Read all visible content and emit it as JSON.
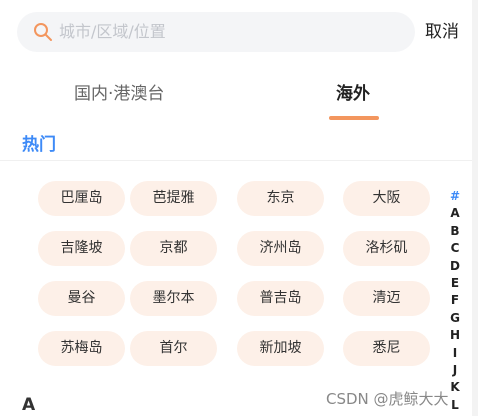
{
  "search": {
    "icon": "search-icon",
    "placeholder": "城市/区域/位置",
    "accent_color": "#f3965e"
  },
  "cancel_label": "取消",
  "tabs": [
    {
      "label": "国内·港澳台",
      "active": false
    },
    {
      "label": "海外",
      "active": true
    }
  ],
  "hot_section": {
    "title": "热门",
    "cities": [
      "巴厘岛",
      "芭提雅",
      "东京",
      "大阪",
      "吉隆坡",
      "京都",
      "济州岛",
      "洛杉矶",
      "曼谷",
      "墨尔本",
      "普吉岛",
      "清迈",
      "苏梅岛",
      "首尔",
      "新加坡",
      "悉尼"
    ]
  },
  "index_letters": [
    "#",
    "A",
    "B",
    "C",
    "D",
    "E",
    "F",
    "G",
    "H",
    "I",
    "J",
    "K",
    "L"
  ],
  "section_a_title": "A",
  "watermark": "CSDN @虎鲸大大",
  "colors": {
    "active_blue": "#3d8af7",
    "chip_bg": "#fdf0e8",
    "tab_underline": "#f3965e"
  }
}
